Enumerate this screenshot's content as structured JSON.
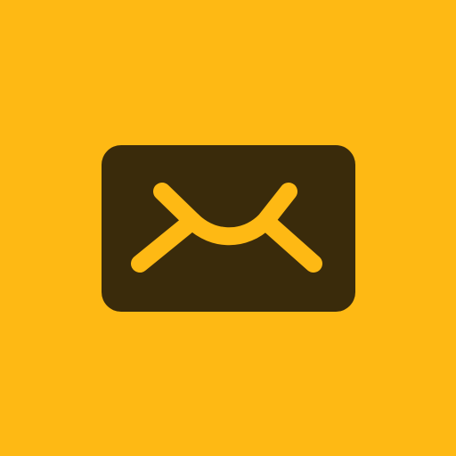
{
  "icon": {
    "name": "mail-icon",
    "background_color": "#FEB914",
    "envelope_color": "#3A2B0B",
    "stroke_color": "#FEB914"
  }
}
